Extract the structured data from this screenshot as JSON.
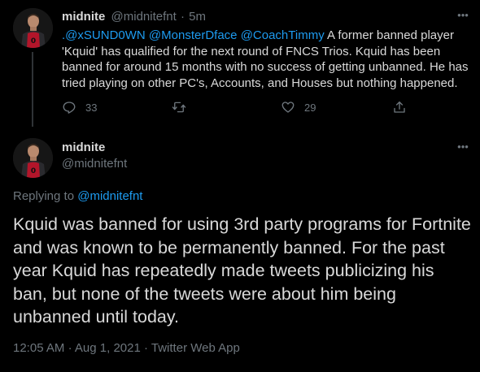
{
  "colors": {
    "background": "#000000",
    "text": "#d9d9d9",
    "muted": "#6e767d",
    "link": "#1d9bf0",
    "divider": "#2f3336"
  },
  "parent_tweet": {
    "author_name": "midnite",
    "author_handle": "@midnitefnt",
    "separator": "·",
    "time": "5m",
    "more_icon": "more-dots-icon",
    "mentions": [
      ".@xSUND0WN",
      "@MonsterDface",
      "@CoachTimmy"
    ],
    "text": "A former banned player 'Kquid' has qualified for the next round of FNCS Trios. Kquid has been banned for around 15 months with no success of getting unbanned. He has tried playing on other PC's, Accounts, and Houses but nothing happened.",
    "actions": {
      "reply": {
        "icon": "reply-icon",
        "count": "33"
      },
      "retweet": {
        "icon": "retweet-icon"
      },
      "like": {
        "icon": "heart-icon",
        "count": "29"
      },
      "share": {
        "icon": "share-icon"
      }
    }
  },
  "main_tweet": {
    "author_name": "midnite",
    "author_handle": "@midnitefnt",
    "more_icon": "more-dots-icon",
    "replying_to_label": "Replying to",
    "replying_to_handle": "@midnitefnt",
    "text": "Kquid was banned for using 3rd party programs for Fortnite and was known to be permanently banned. For the past year Kquid has repeatedly made tweets publicizing his ban, but none of the tweets were about him being unbanned until today.",
    "time": "12:05 AM",
    "date": "Aug 1, 2021",
    "source": "Twitter Web App",
    "separator": "·"
  }
}
